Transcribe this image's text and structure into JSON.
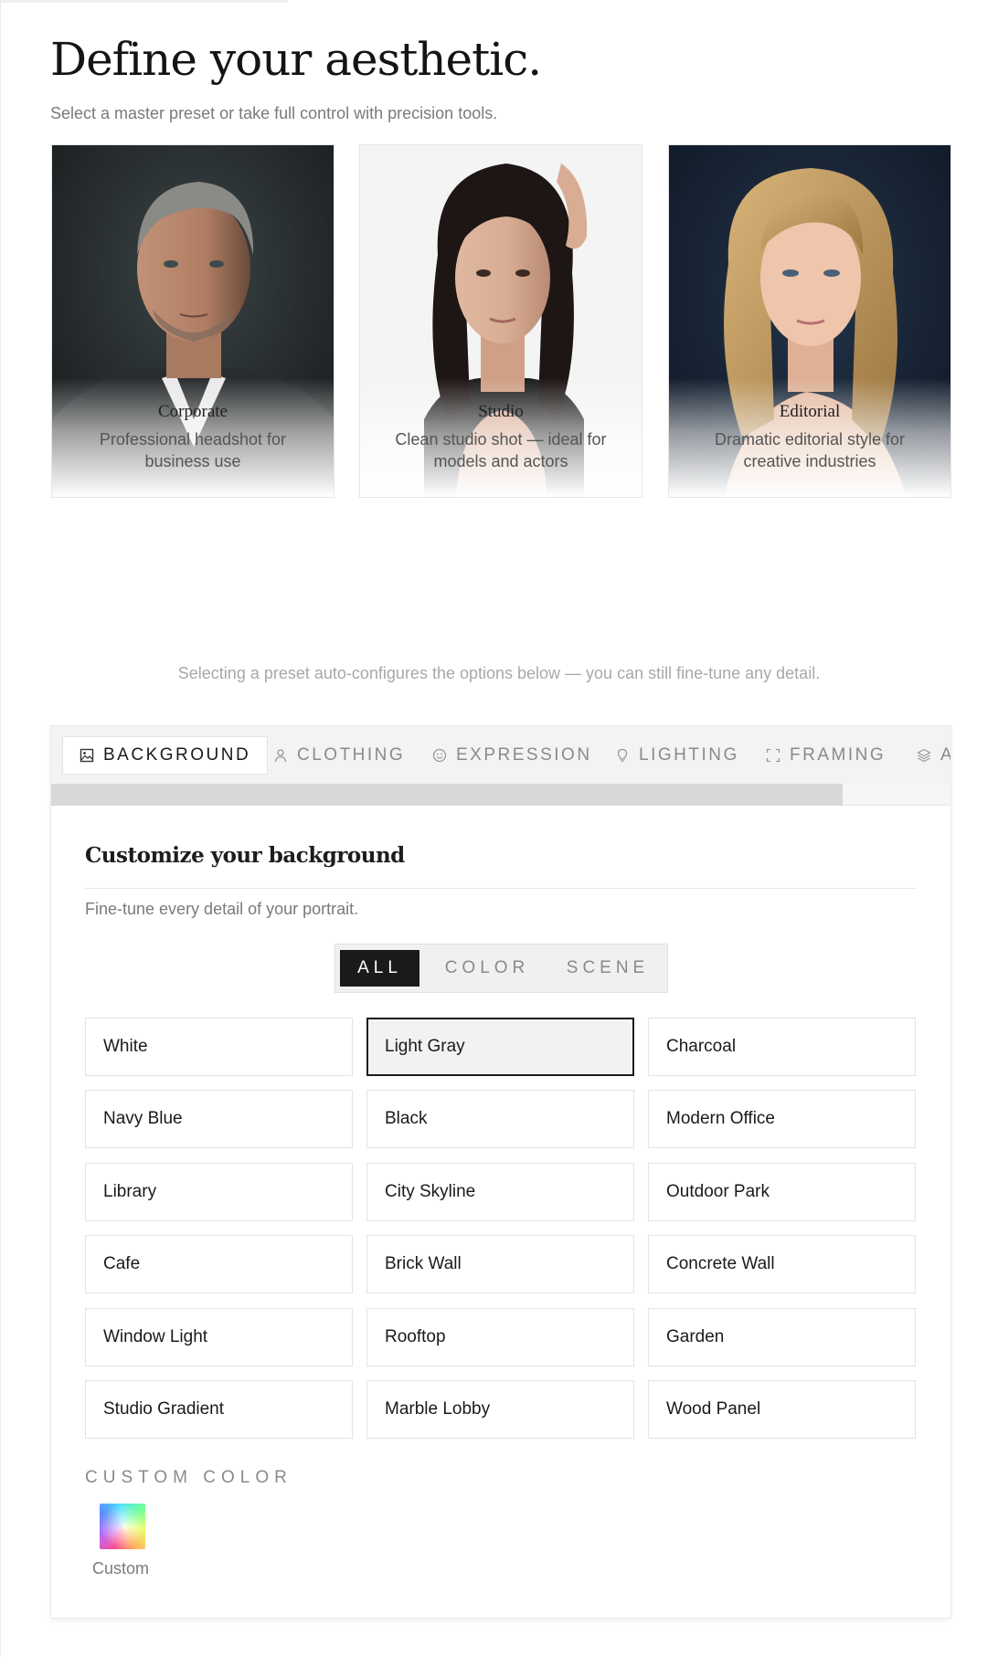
{
  "header": {
    "title": "Define your aesthetic.",
    "subtitle": "Select a master preset or take full control with precision tools."
  },
  "presets": [
    {
      "name": "Corporate",
      "description": "Professional headshot for business use"
    },
    {
      "name": "Studio",
      "description": "Clean studio shot — ideal for models and actors"
    },
    {
      "name": "Editorial",
      "description": "Dramatic editorial style for creative industries"
    }
  ],
  "hint": "Selecting a preset auto-configures the options below — you can still fine-tune any detail.",
  "tabs": [
    {
      "label": "BACKGROUND",
      "icon": "image-icon",
      "active": true
    },
    {
      "label": "CLOTHING",
      "icon": "person-icon",
      "active": false
    },
    {
      "label": "EXPRESSION",
      "icon": "smile-icon",
      "active": false
    },
    {
      "label": "LIGHTING",
      "icon": "bulb-icon",
      "active": false
    },
    {
      "label": "FRAMING",
      "icon": "frame-icon",
      "active": false
    },
    {
      "label": "A",
      "icon": "layers-icon",
      "active": false
    }
  ],
  "tab_scroll_fraction": 0.88,
  "section": {
    "title": "Customize your background",
    "subtitle": "Fine-tune every detail of your portrait."
  },
  "filters": [
    {
      "label": "ALL",
      "active": true
    },
    {
      "label": "COLOR",
      "active": false
    },
    {
      "label": "SCENE",
      "active": false
    }
  ],
  "options": [
    "White",
    "Light Gray",
    "Charcoal",
    "Navy Blue",
    "Black",
    "Modern Office",
    "Library",
    "City Skyline",
    "Outdoor Park",
    "Cafe",
    "Brick Wall",
    "Concrete Wall",
    "Window Light",
    "Rooftop",
    "Garden",
    "Studio Gradient",
    "Marble Lobby",
    "Wood Panel"
  ],
  "selected_option": "Light Gray",
  "custom_color": {
    "heading": "CUSTOM COLOR",
    "label": "Custom"
  },
  "colors": {
    "accent": "#1a1a1a",
    "muted_text": "#7a7a7a",
    "tab_bar_bg": "#f3f3f3"
  }
}
